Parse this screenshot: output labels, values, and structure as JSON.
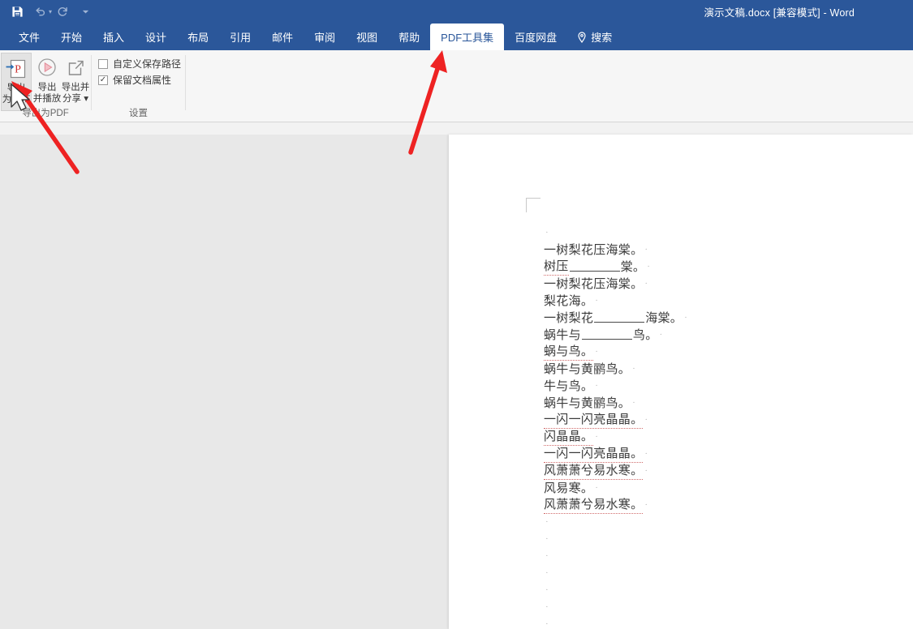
{
  "window": {
    "title": "演示文稿.docx [兼容模式]  -  Word",
    "accent_color": "#2b579a",
    "ribbon_bg": "#f6f6f6",
    "workspace_bg": "#e8e8e8",
    "annotation_color": "#ee2222"
  },
  "quick_access": {
    "items": [
      {
        "name": "save-icon",
        "label": "保存"
      },
      {
        "name": "undo-icon",
        "label": "撤消"
      },
      {
        "name": "redo-icon",
        "label": "恢复"
      },
      {
        "name": "customize-qat-icon",
        "label": "自定义快速访问工具栏"
      }
    ]
  },
  "tabs": [
    {
      "label": "文件",
      "active": false
    },
    {
      "label": "开始",
      "active": false
    },
    {
      "label": "插入",
      "active": false
    },
    {
      "label": "设计",
      "active": false
    },
    {
      "label": "布局",
      "active": false
    },
    {
      "label": "引用",
      "active": false
    },
    {
      "label": "邮件",
      "active": false
    },
    {
      "label": "审阅",
      "active": false
    },
    {
      "label": "视图",
      "active": false
    },
    {
      "label": "帮助",
      "active": false
    },
    {
      "label": "PDF工具集",
      "active": true
    },
    {
      "label": "百度网盘",
      "active": false
    },
    {
      "label": "搜索",
      "active": false,
      "icon": "search-icon"
    }
  ],
  "ribbon": {
    "groups": [
      {
        "name": "export-to-pdf",
        "label": "导出为PDF",
        "buttons": [
          {
            "name": "export-to-pdf-button",
            "line1": "导出",
            "line2": "为PDF",
            "icon": "pdf-export-icon",
            "selected": true
          },
          {
            "name": "export-and-play-button",
            "line1": "导出",
            "line2": "并播放",
            "icon": "play-circle-icon",
            "selected": false
          },
          {
            "name": "export-and-share-button",
            "line1": "导出并",
            "line2": "分享 ▾",
            "icon": "share-box-icon",
            "selected": false
          }
        ]
      },
      {
        "name": "settings",
        "label": "设置",
        "checkboxes": [
          {
            "name": "custom-save-path-checkbox",
            "label": "自定义保存路径",
            "checked": false
          },
          {
            "name": "keep-doc-properties-checkbox",
            "label": "保留文档属性",
            "checked": true
          }
        ]
      }
    ]
  },
  "document": {
    "lines": [
      {
        "type": "mark"
      },
      {
        "type": "text",
        "text": "一树梨花压海棠。"
      },
      {
        "type": "blankline",
        "prefix": "树压",
        "suffix": "棠。",
        "misspelled": true
      },
      {
        "type": "text",
        "text": "一树梨花压海棠。"
      },
      {
        "type": "text",
        "text": "梨花海。"
      },
      {
        "type": "blankline",
        "prefix": "一树梨花",
        "suffix": "海棠。",
        "misspelled": false
      },
      {
        "type": "blankline",
        "prefix": "蜗牛与",
        "suffix": "鸟。",
        "misspelled": false
      },
      {
        "type": "text",
        "text": "蜗与鸟。",
        "misspelled": true
      },
      {
        "type": "text",
        "text": "蜗牛与黄鹂鸟。"
      },
      {
        "type": "text",
        "text": "牛与鸟。"
      },
      {
        "type": "text",
        "text": "蜗牛与黄鹂鸟。"
      },
      {
        "type": "text",
        "text": "一闪一闪亮晶晶。",
        "misspelled": true
      },
      {
        "type": "text",
        "text": "闪晶晶。",
        "misspelled": true
      },
      {
        "type": "text",
        "text": "一闪一闪亮晶晶。",
        "misspelled": true
      },
      {
        "type": "text",
        "text": "风萧萧兮易水寒。",
        "misspelled": true
      },
      {
        "type": "text",
        "text": "风易寒。"
      },
      {
        "type": "text",
        "text": "风萧萧兮易水寒。",
        "misspelled": true
      },
      {
        "type": "mark"
      },
      {
        "type": "mark"
      },
      {
        "type": "mark"
      },
      {
        "type": "mark"
      },
      {
        "type": "mark"
      },
      {
        "type": "mark"
      },
      {
        "type": "mark"
      }
    ],
    "paragraph_mark": "·"
  },
  "annotations": [
    {
      "name": "arrow-to-export-pdf-button",
      "target": "export-to-pdf-button"
    },
    {
      "name": "arrow-to-pdf-tools-tab",
      "target": "tab-pdf-tools"
    }
  ]
}
